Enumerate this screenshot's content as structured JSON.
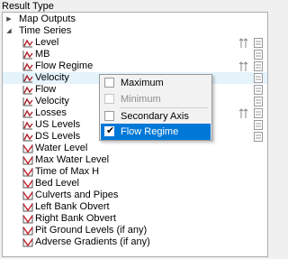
{
  "panel": {
    "title": "Result Type"
  },
  "tree": {
    "map_outputs": {
      "label": "Map Outputs",
      "expanded": false
    },
    "time_series": {
      "label": "Time Series",
      "expanded": true,
      "items": [
        {
          "label": "Level",
          "icon": "series-icon"
        },
        {
          "label": "MB",
          "icon": "series-icon"
        },
        {
          "label": "Flow Regime",
          "icon": "series-icon"
        },
        {
          "label": "Velocity",
          "icon": "series-icon"
        },
        {
          "label": "Flow",
          "icon": "series-icon"
        },
        {
          "label": "Velocity",
          "icon": "series-icon"
        },
        {
          "label": "Losses",
          "icon": "series-icon"
        },
        {
          "label": "US Levels",
          "icon": "series-icon"
        },
        {
          "label": "DS Levels",
          "icon": "series-icon"
        }
      ]
    },
    "long_profile_items": [
      {
        "label": "Water Level",
        "icon": "long-profile-icon"
      },
      {
        "label": "Max Water Level",
        "icon": "long-profile-icon"
      },
      {
        "label": "Time of Max H",
        "icon": "long-profile-icon"
      },
      {
        "label": "Bed Level",
        "icon": "long-profile-icon"
      },
      {
        "label": "Culverts and Pipes",
        "icon": "long-profile-icon"
      },
      {
        "label": "Left Bank Obvert",
        "icon": "long-profile-icon"
      },
      {
        "label": "Right Bank Obvert",
        "icon": "long-profile-icon"
      },
      {
        "label": "Pit Ground Levels (if any)",
        "icon": "long-profile-icon"
      },
      {
        "label": "Adverse Gradients (if any)",
        "icon": "long-profile-icon"
      }
    ]
  },
  "context_menu": {
    "items": [
      {
        "label": "Maximum",
        "checked": false,
        "enabled": true,
        "highlighted": false
      },
      {
        "label": "Minimum",
        "checked": false,
        "enabled": false,
        "highlighted": false
      },
      {
        "label": "Secondary Axis",
        "checked": false,
        "enabled": true,
        "highlighted": false
      },
      {
        "label": "Flow Regime",
        "checked": true,
        "enabled": true,
        "highlighted": true
      }
    ]
  },
  "colors": {
    "series_icon": "#b0202a",
    "long_profile_icon": "#c8202a",
    "menu_selected": "#0078d7",
    "row_hover": "#e5f3fb"
  }
}
